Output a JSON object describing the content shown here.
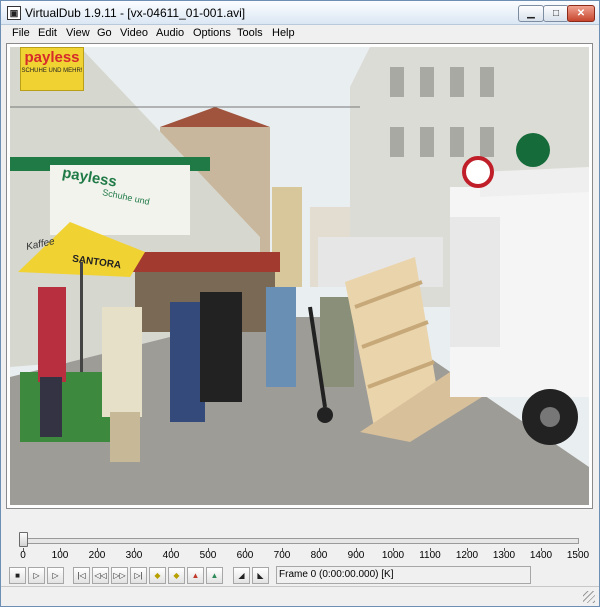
{
  "window": {
    "title": "VirtualDub 1.9.11 - [vx-04611_01-001.avi]",
    "icon": "film-reel-icon"
  },
  "menu": [
    "File",
    "Edit",
    "View",
    "Go",
    "Video",
    "Audio",
    "Options",
    "Tools",
    "Help"
  ],
  "video_signs": {
    "payless_top": "payless",
    "payless_sub": "SCHUHE UND MEHR!",
    "payless_store": "payless",
    "schuhe": "Schuhe und",
    "kaffee": "Kaffee",
    "santora": "SANTORA"
  },
  "timeline": {
    "ticks": [
      "0",
      "100",
      "200",
      "300",
      "400",
      "500",
      "600",
      "700",
      "800",
      "900",
      "1000",
      "1100",
      "1200",
      "1300",
      "1400",
      "1500"
    ],
    "position": 0
  },
  "toolbar": {
    "buttons": [
      "stop-icon",
      "play-input-icon",
      "play-output-icon",
      "start-icon",
      "prev-frame-icon",
      "next-frame-icon",
      "end-icon",
      "prev-keyframe-icon",
      "next-keyframe-icon",
      "scene-back-icon",
      "scene-forward-icon",
      "mark-in-icon",
      "mark-out-icon"
    ],
    "frame_text": "Frame 0 (0:00:00.000) [K]"
  }
}
